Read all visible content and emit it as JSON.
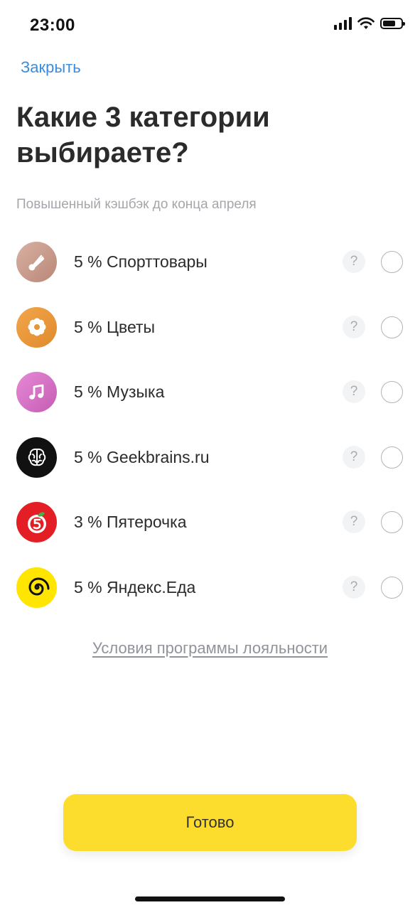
{
  "status_bar": {
    "time": "23:00"
  },
  "header": {
    "close_label": "Закрыть",
    "title": "Какие 3 категории выбираете?",
    "subtitle": "Повышенный кэшбэк до конца апреля"
  },
  "categories": [
    {
      "label": "5 % Спорттовары",
      "icon": "shuttlecock-icon",
      "color": "#c49a8a",
      "help": "?"
    },
    {
      "label": "5 % Цветы",
      "icon": "flower-icon",
      "color": "#e8963a",
      "help": "?"
    },
    {
      "label": "5 % Музыка",
      "icon": "music-note-icon",
      "color": "#d46cc0",
      "help": "?"
    },
    {
      "label": "5 % Geekbrains.ru",
      "icon": "brain-icon",
      "color": "#111111",
      "help": "?"
    },
    {
      "label": "3 % Пятерочка",
      "icon": "pyaterochka-logo-icon",
      "color": "#e31e24",
      "help": "?"
    },
    {
      "label": "5 % Яндекс.Еда",
      "icon": "spiral-icon",
      "color": "#ffe500",
      "help": "?"
    }
  ],
  "footer": {
    "loyalty_link": "Условия программы лояльности",
    "done_label": "Готово"
  }
}
